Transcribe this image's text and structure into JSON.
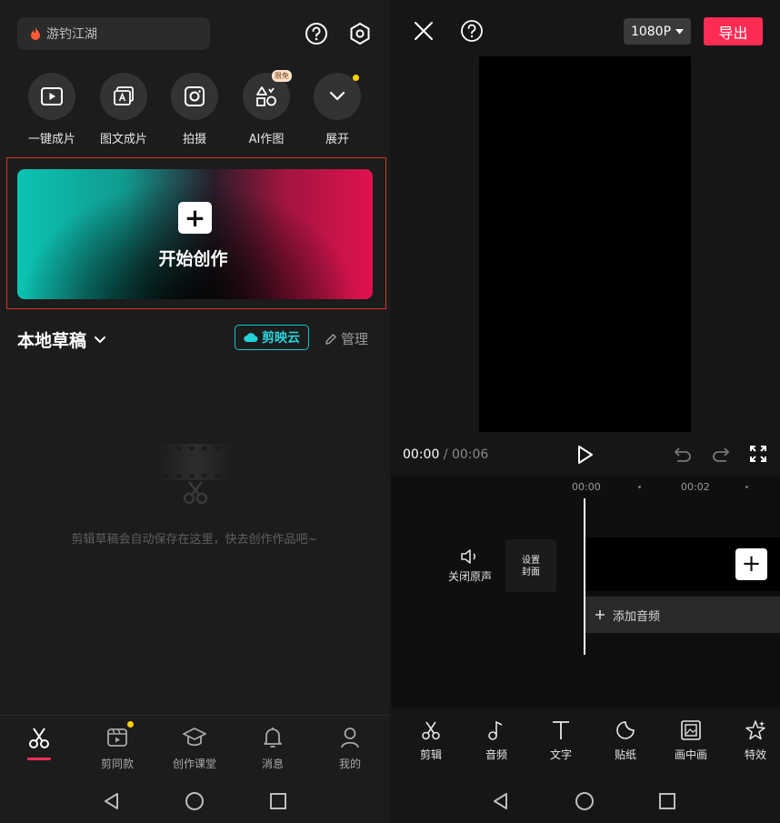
{
  "left": {
    "search": {
      "icon": "flame-icon",
      "text": "游钓江湖"
    },
    "header_icons": [
      "help-icon",
      "settings-icon"
    ],
    "quick_actions": [
      {
        "label": "一键成片",
        "icon": "play-square-icon"
      },
      {
        "label": "图文成片",
        "icon": "image-text-icon"
      },
      {
        "label": "拍摄",
        "icon": "camera-icon"
      },
      {
        "label": "AI作图",
        "icon": "ai-image-icon",
        "badge": "限免"
      },
      {
        "label": "展开",
        "icon": "chevron-down-icon",
        "dot": true
      }
    ],
    "create": {
      "label": "开始创作",
      "plus": "+"
    },
    "drafts": {
      "title": "本地草稿",
      "cloud": "剪映云",
      "manage": "管理"
    },
    "empty": {
      "text": "剪辑草稿会自动保存在这里，快去创作作品吧~"
    },
    "tabs": [
      {
        "label": "",
        "icon": "scissors-icon",
        "active": true
      },
      {
        "label": "剪同款",
        "icon": "template-icon",
        "dot": true
      },
      {
        "label": "创作课堂",
        "icon": "graduation-cap-icon"
      },
      {
        "label": "消息",
        "icon": "bell-icon"
      },
      {
        "label": "我的",
        "icon": "person-icon"
      }
    ]
  },
  "right": {
    "resolution": "1080P",
    "export": "导出",
    "time_current": "00:00",
    "time_sep": " / ",
    "time_total": "00:06",
    "ticks": [
      "00:00",
      "00:02"
    ],
    "mute_label": "关闭原声",
    "cover_line1": "设置",
    "cover_line2": "封面",
    "add_audio": "添加音频",
    "tools": [
      {
        "label": "剪辑",
        "icon": "scissors-icon"
      },
      {
        "label": "音频",
        "icon": "music-note-icon"
      },
      {
        "label": "文字",
        "icon": "text-icon"
      },
      {
        "label": "贴纸",
        "icon": "sticker-icon"
      },
      {
        "label": "画中画",
        "icon": "picture-in-picture-icon"
      },
      {
        "label": "特效",
        "icon": "effects-star-icon"
      }
    ]
  },
  "colors": {
    "accent": "#fe2c55",
    "cloud": "#18c2c9",
    "highlight_frame": "#d8342b"
  }
}
